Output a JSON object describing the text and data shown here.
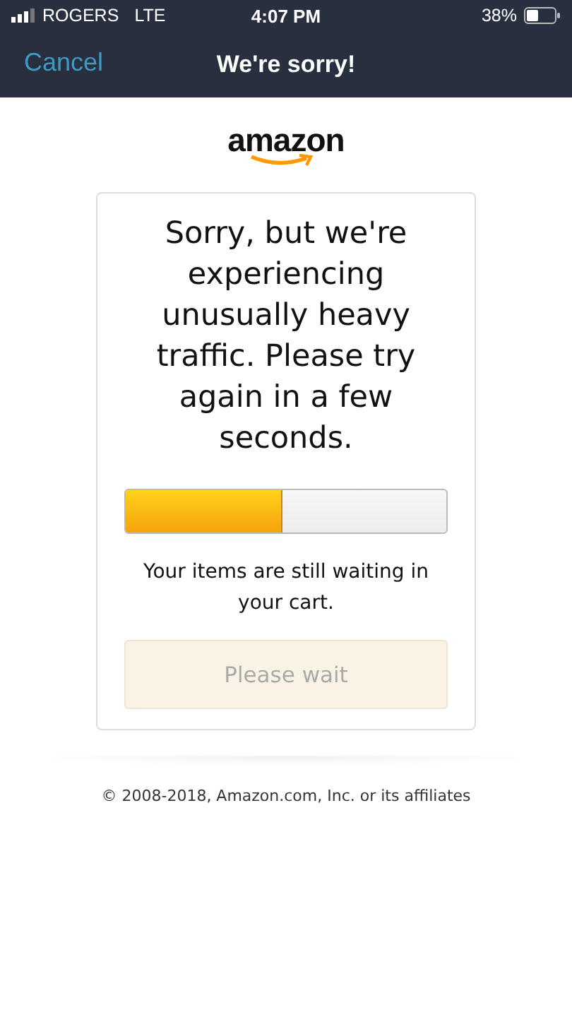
{
  "status_bar": {
    "carrier": "ROGERS",
    "network": "LTE",
    "time": "4:07 PM",
    "battery": "38%"
  },
  "nav_bar": {
    "back": "Cancel",
    "title": "We're sorry!"
  },
  "logo": {
    "text": "amazon"
  },
  "card": {
    "message": "Sorry, but we're experiencing unusually heavy traffic. Please try again in a few seconds.",
    "progress": {
      "level": 0.49
    },
    "note": "Your items are still waiting in your cart.",
    "button": {
      "label": "Please wait",
      "disabled": true
    }
  },
  "footer": "© 2008-2018, Amazon.com, Inc. or its affiliates"
}
